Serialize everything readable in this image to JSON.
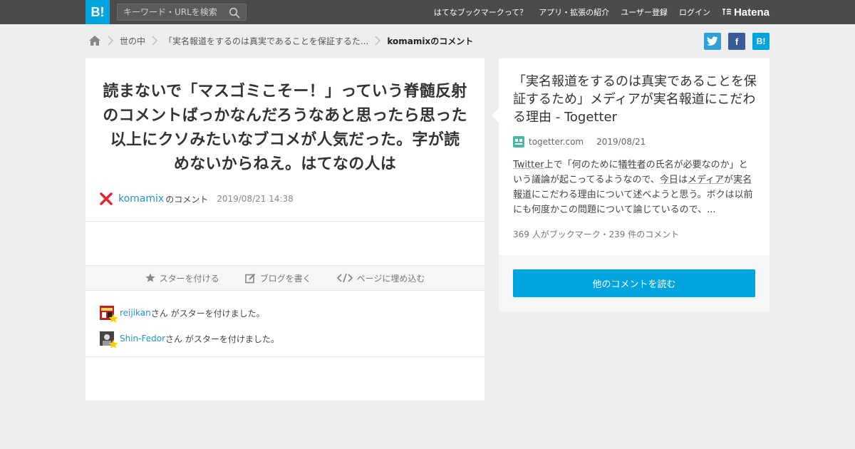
{
  "header": {
    "logo_text": "B!",
    "search_placeholder": "キーワード・URLを検索",
    "nav": [
      "はてなブックマークって？",
      "アプリ・拡張の紹介",
      "ユーザー登録",
      "ログイン"
    ],
    "brand": "Hatena"
  },
  "breadcrumb": {
    "items": [
      "世の中",
      "「実名報道をするのは真実であることを保証するた..."
    ],
    "current": "komamixのコメント"
  },
  "share": {
    "facebook": "f",
    "hatebu": "B!"
  },
  "comment": {
    "text": "読まないで「マスゴミこそー！」っていう脊髄反射のコメントばっかなんだろうなあと思ったら思った以上にクソみたいなブコメが人気だった。字が読めないからねえ。はてなの人は",
    "author": "komamix",
    "author_suffix": "のコメント",
    "date": "2019/08/21 14:38"
  },
  "actions": {
    "star": "スターを付ける",
    "blog": "ブログを書く",
    "embed": "ページに埋め込む"
  },
  "stars": [
    {
      "user": "reijikan",
      "suffix": "さん がスターを付けました。"
    },
    {
      "user": "Shin-Fedor",
      "suffix": "さん がスターを付けました。"
    }
  ],
  "entry": {
    "title": "「実名報道をするのは真実であることを保証するため」メディアが実名報道にこだわる理由 - Togetter",
    "domain": "togetter.com",
    "date": "2019/08/21",
    "desc": {
      "p1": "Twitter",
      "p2": "上で「何のために",
      "p3": "犠牲者",
      "p4": "の氏名が必要なのか」という議論が起こってるようなので、",
      "p5": "今日",
      "p6": "は",
      "p7": "メディア",
      "p8": "が",
      "p9": "実名報道",
      "p10": "にこだわる理由について述べようと思う。ボクは以前にも何度かこの問題について論じているので、..."
    },
    "counts": "369 人がブックマーク・239 件のコメント",
    "read_more": "他のコメントを読む"
  },
  "colors": {
    "brand_blue": "#00a4de",
    "link_blue": "#2694c8",
    "topbar": "#4b4b4b",
    "twitter": "#2fa0d8",
    "facebook": "#3b5a98"
  }
}
